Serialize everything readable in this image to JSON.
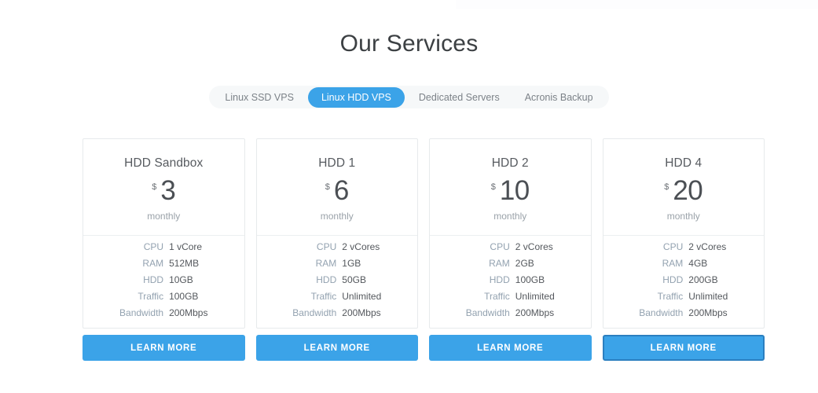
{
  "page": {
    "title": "Our Services"
  },
  "tabs": [
    {
      "label": "Linux SSD VPS",
      "active": false
    },
    {
      "label": "Linux HDD VPS",
      "active": true
    },
    {
      "label": "Dedicated Servers",
      "active": false
    },
    {
      "label": "Acronis Backup",
      "active": false
    }
  ],
  "colors": {
    "accent": "#3ba3e8",
    "accent_dark": "#2b7fc0",
    "tabbar_bg": "#f6f8f9",
    "card_border": "#e7eaec",
    "spec_label": "#93a2b0",
    "spec_value": "#54585d",
    "muted_text": "#9aa2a9",
    "title_text": "#3c4043"
  },
  "spec_labels": [
    "CPU",
    "RAM",
    "HDD",
    "Traffic",
    "Bandwidth"
  ],
  "currency_symbol": "$",
  "period_label": "monthly",
  "button_label": "LEARN MORE",
  "plans": [
    {
      "name": "HDD Sandbox",
      "price": "3",
      "currency": "$",
      "period": "monthly",
      "specs": [
        {
          "label": "CPU",
          "value": "1 vCore"
        },
        {
          "label": "RAM",
          "value": "512MB"
        },
        {
          "label": "HDD",
          "value": "10GB"
        },
        {
          "label": "Traffic",
          "value": "100GB"
        },
        {
          "label": "Bandwidth",
          "value": "200Mbps"
        }
      ],
      "button": "LEARN MORE",
      "button_focused": false
    },
    {
      "name": "HDD 1",
      "price": "6",
      "currency": "$",
      "period": "monthly",
      "specs": [
        {
          "label": "CPU",
          "value": "2 vCores"
        },
        {
          "label": "RAM",
          "value": "1GB"
        },
        {
          "label": "HDD",
          "value": "50GB"
        },
        {
          "label": "Traffic",
          "value": "Unlimited"
        },
        {
          "label": "Bandwidth",
          "value": "200Mbps"
        }
      ],
      "button": "LEARN MORE",
      "button_focused": false
    },
    {
      "name": "HDD 2",
      "price": "10",
      "currency": "$",
      "period": "monthly",
      "specs": [
        {
          "label": "CPU",
          "value": "2 vCores"
        },
        {
          "label": "RAM",
          "value": "2GB"
        },
        {
          "label": "HDD",
          "value": "100GB"
        },
        {
          "label": "Traffic",
          "value": "Unlimited"
        },
        {
          "label": "Bandwidth",
          "value": "200Mbps"
        }
      ],
      "button": "LEARN MORE",
      "button_focused": false
    },
    {
      "name": "HDD 4",
      "price": "20",
      "currency": "$",
      "period": "monthly",
      "specs": [
        {
          "label": "CPU",
          "value": "2 vCores"
        },
        {
          "label": "RAM",
          "value": "4GB"
        },
        {
          "label": "HDD",
          "value": "200GB"
        },
        {
          "label": "Traffic",
          "value": "Unlimited"
        },
        {
          "label": "Bandwidth",
          "value": "200Mbps"
        }
      ],
      "button": "LEARN MORE",
      "button_focused": true
    }
  ]
}
